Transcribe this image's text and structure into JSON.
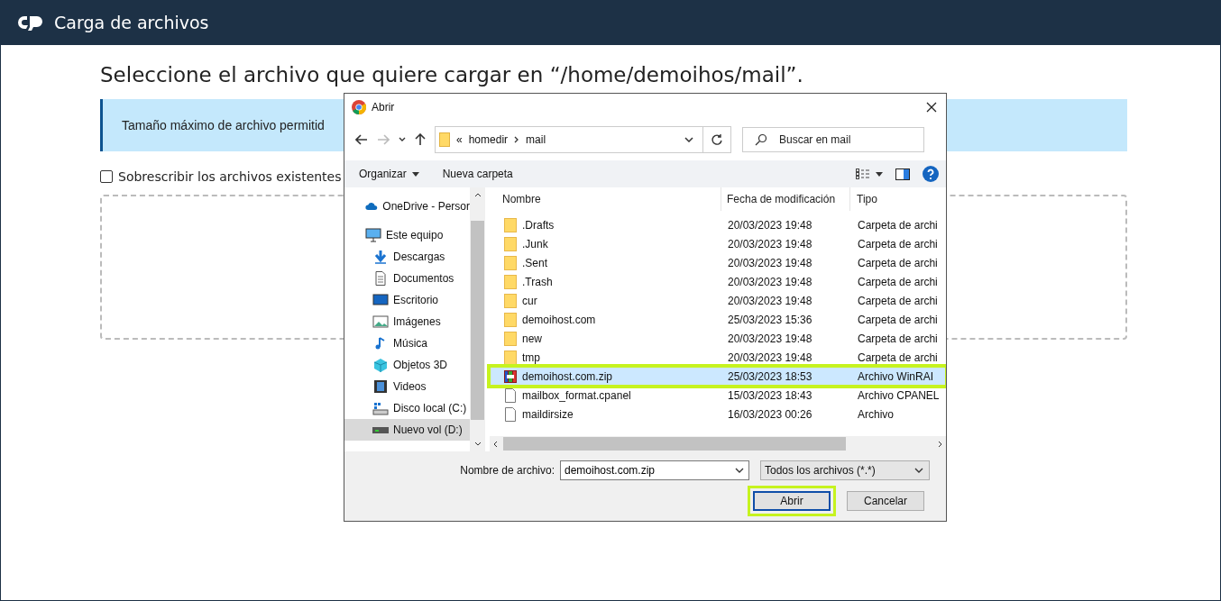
{
  "app_bar": {
    "title": "Carga de archivos"
  },
  "page": {
    "heading": "Seleccione el archivo que quiere cargar en “/home/demoihos/mail”.",
    "notice": "Tamaño máximo de archivo permitid",
    "overwrite": {
      "label": "Sobrescribir los archivos existentes",
      "checked": false
    }
  },
  "dialog": {
    "title": "Abrir",
    "breadcrumb_overflow": "«",
    "breadcrumb": [
      "homedir",
      "mail"
    ],
    "search_placeholder": "Buscar en mail",
    "toolbar": [
      "Organizar",
      "Nueva carpeta"
    ],
    "sidebar": [
      {
        "label": "OneDrive - Persor",
        "kind": "cloud",
        "selected": false
      },
      {
        "label": "Este equipo",
        "kind": "pc",
        "selected": false
      },
      {
        "label": "Descargas",
        "kind": "download",
        "selected": false
      },
      {
        "label": "Documentos",
        "kind": "document",
        "selected": false
      },
      {
        "label": "Escritorio",
        "kind": "desktop",
        "selected": false
      },
      {
        "label": "Imágenes",
        "kind": "image",
        "selected": false
      },
      {
        "label": "Música",
        "kind": "music",
        "selected": false
      },
      {
        "label": "Objetos 3D",
        "kind": "cube",
        "selected": false
      },
      {
        "label": "Videos",
        "kind": "video",
        "selected": false
      },
      {
        "label": "Disco local (C:)",
        "kind": "disk",
        "selected": false
      },
      {
        "label": "Nuevo vol (D:)",
        "kind": "drive",
        "selected": true
      }
    ],
    "columns": [
      "Nombre",
      "Fecha de modificación",
      "Tipo"
    ],
    "files": [
      {
        "name": ".Drafts",
        "date": "20/03/2023 19:48",
        "type": "Carpeta de archi",
        "kind": "folder",
        "selected": false,
        "highlighted": false
      },
      {
        "name": ".Junk",
        "date": "20/03/2023 19:48",
        "type": "Carpeta de archi",
        "kind": "folder",
        "selected": false,
        "highlighted": false
      },
      {
        "name": ".Sent",
        "date": "20/03/2023 19:48",
        "type": "Carpeta de archi",
        "kind": "folder",
        "selected": false,
        "highlighted": false
      },
      {
        "name": ".Trash",
        "date": "20/03/2023 19:48",
        "type": "Carpeta de archi",
        "kind": "folder",
        "selected": false,
        "highlighted": false
      },
      {
        "name": "cur",
        "date": "20/03/2023 19:48",
        "type": "Carpeta de archi",
        "kind": "folder",
        "selected": false,
        "highlighted": false
      },
      {
        "name": "demoihost.com",
        "date": "25/03/2023 15:36",
        "type": "Carpeta de archi",
        "kind": "folder",
        "selected": false,
        "highlighted": false
      },
      {
        "name": "new",
        "date": "20/03/2023 19:48",
        "type": "Carpeta de archi",
        "kind": "folder",
        "selected": false,
        "highlighted": false
      },
      {
        "name": "tmp",
        "date": "20/03/2023 19:48",
        "type": "Carpeta de archi",
        "kind": "folder",
        "selected": false,
        "highlighted": false
      },
      {
        "name": "demoihost.com.zip",
        "date": "25/03/2023 18:53",
        "type": "Archivo WinRAI",
        "kind": "archive",
        "selected": true,
        "highlighted": true
      },
      {
        "name": "mailbox_format.cpanel",
        "date": "15/03/2023 18:43",
        "type": "Archivo CPANEL",
        "kind": "file",
        "selected": false,
        "highlighted": false
      },
      {
        "name": "maildirsize",
        "date": "16/03/2023 00:26",
        "type": "Archivo",
        "kind": "file",
        "selected": false,
        "highlighted": false
      }
    ],
    "filename_label": "Nombre de archivo:",
    "filename": "demoihost.com.zip",
    "filter": "Todos los archivos (*.*)",
    "buttons": [
      {
        "label": "Abrir",
        "kind": "primary",
        "highlighted": true
      },
      {
        "label": "Cancelar",
        "kind": "normal",
        "highlighted": false
      }
    ]
  }
}
